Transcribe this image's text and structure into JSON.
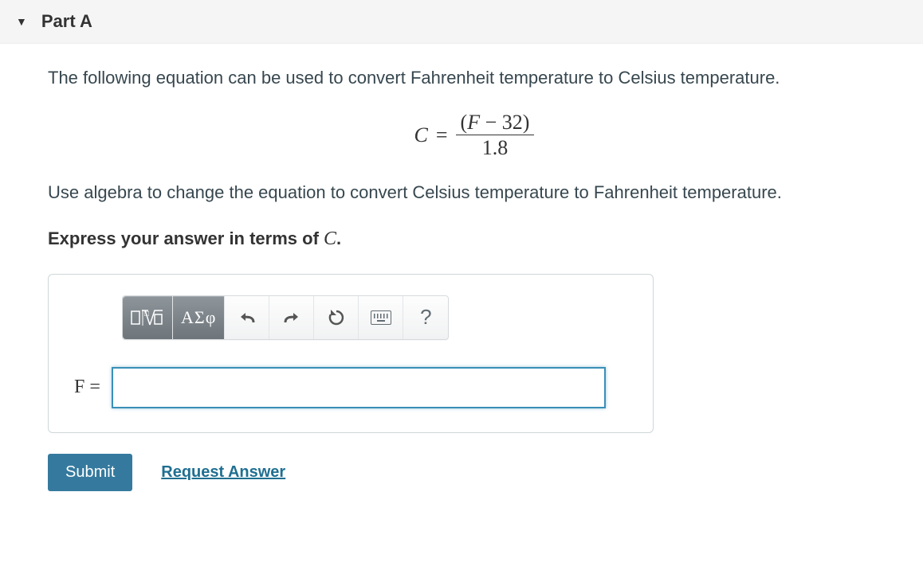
{
  "header": {
    "title": "Part A"
  },
  "body": {
    "intro": "The following equation can be used to convert Fahrenheit temperature to Celsius temperature.",
    "equation": {
      "lhs": "C",
      "eq": "=",
      "numerator_pre": "(",
      "numerator_var": "F",
      "numerator_op": " − 32",
      "numerator_post": ")",
      "denominator": "1.8"
    },
    "instruction": "Use algebra to change the equation to convert Celsius temperature to Fahrenheit temperature.",
    "express_prefix": "Express your answer in terms of ",
    "express_var": "C",
    "express_suffix": "."
  },
  "toolbar": {
    "templates_label": "math templates",
    "greek_label": "ΑΣφ",
    "undo_label": "undo",
    "redo_label": "redo",
    "reset_label": "reset",
    "keyboard_label": "keyboard",
    "help_label": "?"
  },
  "answer": {
    "var": "F",
    "eq": "=",
    "value": ""
  },
  "actions": {
    "submit": "Submit",
    "request": "Request Answer"
  }
}
